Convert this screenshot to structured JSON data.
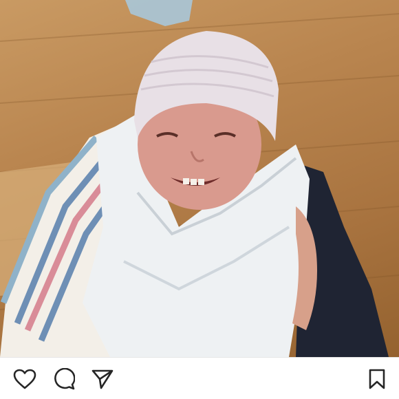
{
  "post": {
    "photo_icon": "baby-photo",
    "actions": {
      "like_icon": "heart-icon",
      "comment_icon": "comment-bubble-icon",
      "share_icon": "paper-plane-icon",
      "save_icon": "bookmark-icon"
    }
  },
  "colors": {
    "icon_stroke": "#262626",
    "background": "#ffffff",
    "floor": "#b9854f"
  }
}
